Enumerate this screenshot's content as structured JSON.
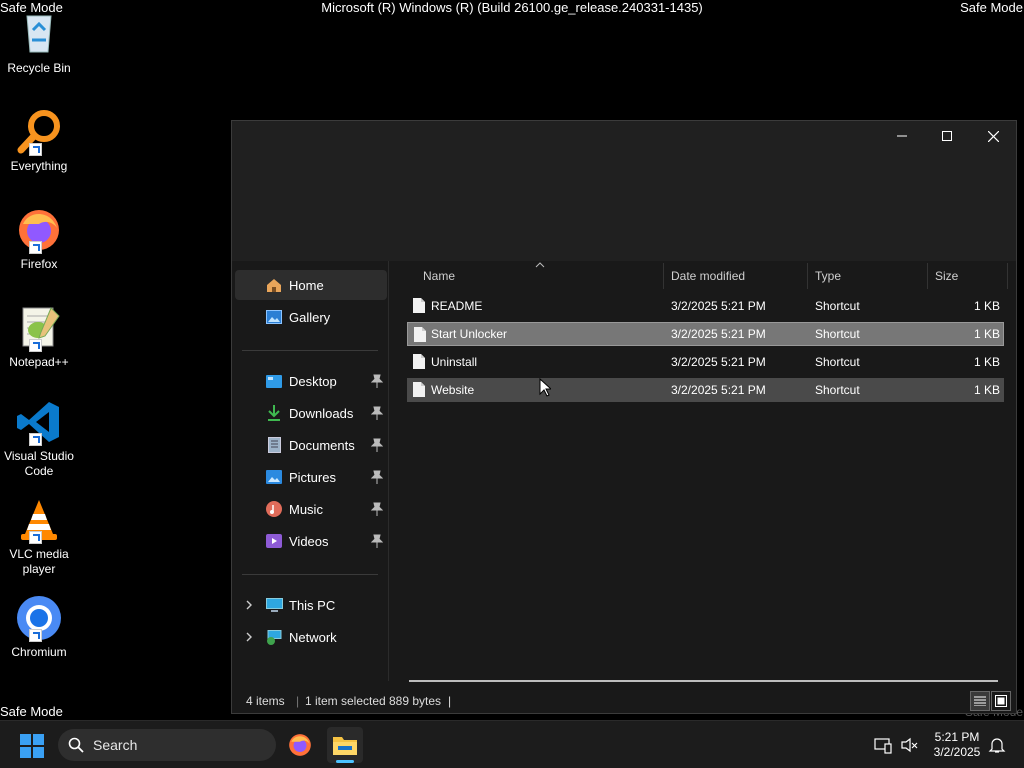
{
  "system": {
    "safe_mode": "Safe Mode",
    "build": "Microsoft (R) Windows (R) (Build 26100.ge_release.240331-1435)"
  },
  "desktop_icons": [
    {
      "label": "Recycle Bin",
      "icon": "recycle-bin-icon"
    },
    {
      "label": "Everything",
      "icon": "everything-magnifier-icon"
    },
    {
      "label": "Firefox",
      "icon": "firefox-icon"
    },
    {
      "label": "Notepad++",
      "icon": "notepad-plus-plus-icon"
    },
    {
      "label": "Visual Studio Code",
      "icon": "vscode-icon"
    },
    {
      "label": "VLC media player",
      "icon": "vlc-cone-icon"
    },
    {
      "label": "Chromium",
      "icon": "chromium-icon"
    }
  ],
  "explorer": {
    "nav": {
      "home": "Home",
      "gallery": "Gallery",
      "pinned": [
        {
          "label": "Desktop",
          "icon": "desktop-folder-icon"
        },
        {
          "label": "Downloads",
          "icon": "downloads-icon"
        },
        {
          "label": "Documents",
          "icon": "documents-icon"
        },
        {
          "label": "Pictures",
          "icon": "pictures-icon"
        },
        {
          "label": "Music",
          "icon": "music-icon"
        },
        {
          "label": "Videos",
          "icon": "videos-icon"
        }
      ],
      "this_pc": "This PC",
      "network": "Network"
    },
    "columns": {
      "name": "Name",
      "date": "Date modified",
      "type": "Type",
      "size": "Size"
    },
    "files": [
      {
        "name": "README",
        "date": "3/2/2025 5:21 PM",
        "type": "Shortcut",
        "size": "1 KB",
        "state": "normal"
      },
      {
        "name": "Start Unlocker",
        "date": "3/2/2025 5:21 PM",
        "type": "Shortcut",
        "size": "1 KB",
        "state": "selected"
      },
      {
        "name": "Uninstall",
        "date": "3/2/2025 5:21 PM",
        "type": "Shortcut",
        "size": "1 KB",
        "state": "normal"
      },
      {
        "name": "Website",
        "date": "3/2/2025 5:21 PM",
        "type": "Shortcut",
        "size": "1 KB",
        "state": "hover"
      }
    ],
    "status": {
      "items": "4 items",
      "selected": "1 item selected",
      "bytes": "889 bytes",
      "divider": "|"
    }
  },
  "taskbar": {
    "search_placeholder": "Search",
    "time": "5:21 PM",
    "date": "3/2/2025"
  },
  "colors": {
    "accent": "#4cc2ff",
    "window_bg": "#191919",
    "titlebar_bg": "#202020",
    "selection": "#777777"
  }
}
